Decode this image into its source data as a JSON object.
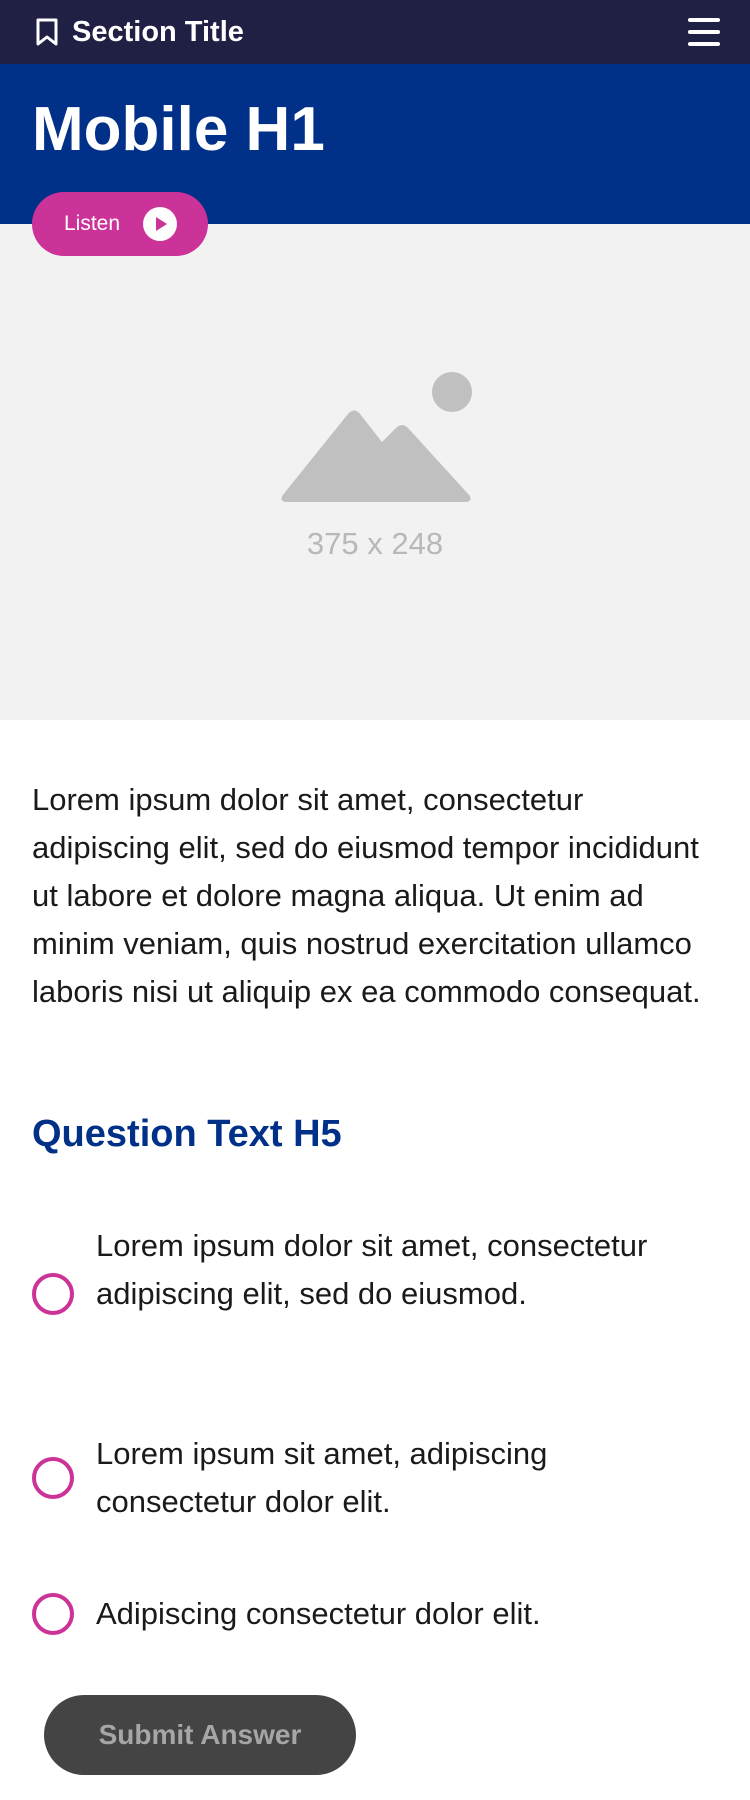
{
  "header": {
    "section_title": "Section Title",
    "icons": {
      "bookmark": "bookmark-icon",
      "menu": "hamburger-menu-icon"
    },
    "background_color": "#201f44"
  },
  "hero": {
    "title": "Mobile H1",
    "background_color": "#003087",
    "listen_button": {
      "label": "Listen",
      "icon": "play-icon",
      "color": "#cc3399"
    }
  },
  "image_placeholder": {
    "size_label": "375 x 248",
    "icon": "image-placeholder-icon"
  },
  "main": {
    "body_text": "Lorem ipsum dolor sit amet, consectetur adipiscing elit, sed do eiusmod tempor incididunt ut labore et dolore magna aliqua. Ut enim ad minim veniam, quis nostrud exercitation ullamco laboris nisi ut aliquip ex ea commodo consequat.",
    "question": {
      "title": "Question Text H5",
      "options": [
        {
          "label": "Lorem ipsum dolor sit amet, consectetur adipiscing elit, sed do eiusmod.",
          "selected": false
        },
        {
          "label": "Lorem ipsum sit amet, adipiscing consectetur dolor elit.",
          "selected": false
        },
        {
          "label": "Adipiscing consectetur dolor elit.",
          "selected": false
        }
      ],
      "submit_label": "Submit Answer"
    }
  },
  "colors": {
    "accent": "#cc3399",
    "brand_blue": "#003087",
    "header_navy": "#201f44",
    "button_disabled": "#444444"
  }
}
